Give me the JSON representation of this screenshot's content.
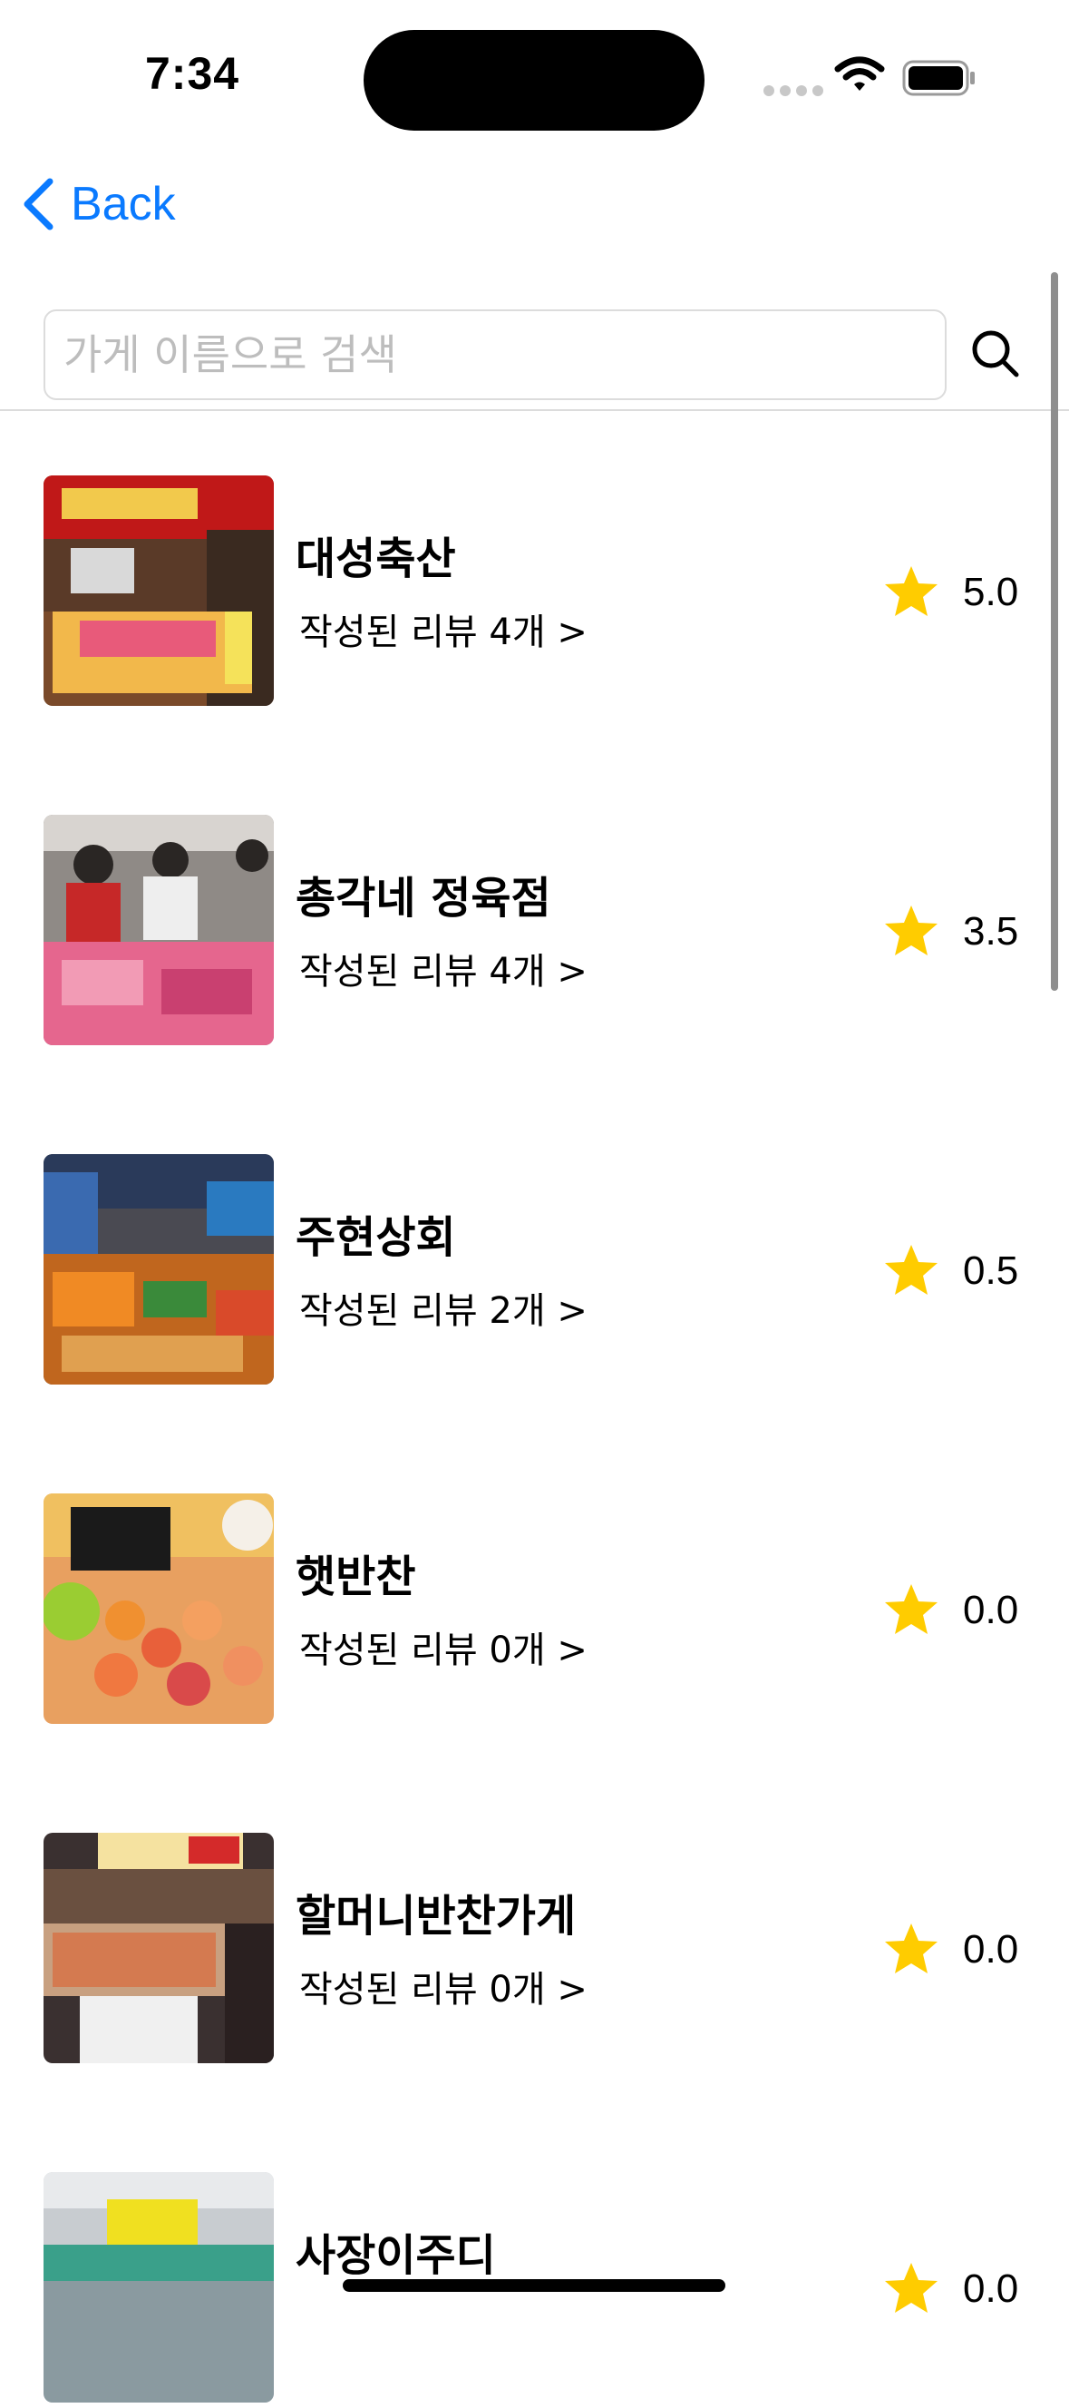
{
  "status_bar": {
    "time": "7:34"
  },
  "nav": {
    "back_label": "Back"
  },
  "search": {
    "placeholder": "가게 이름으로 검색"
  },
  "colors": {
    "accent": "#0a7aff",
    "star": "#ffcc00"
  },
  "stores": [
    {
      "name": "대성축산",
      "reviews": "작성된 리뷰 4개 >",
      "rating": "5.0"
    },
    {
      "name": "총각네 정육점",
      "reviews": "작성된 리뷰 4개 >",
      "rating": "3.5"
    },
    {
      "name": "주현상회",
      "reviews": "작성된 리뷰 2개 >",
      "rating": "0.5"
    },
    {
      "name": "햇반찬",
      "reviews": "작성된 리뷰 0개 >",
      "rating": "0.0"
    },
    {
      "name": "할머니반찬가게",
      "reviews": "작성된 리뷰 0개 >",
      "rating": "0.0"
    },
    {
      "name": "사장이주디",
      "reviews": "",
      "rating": "0.0"
    }
  ]
}
